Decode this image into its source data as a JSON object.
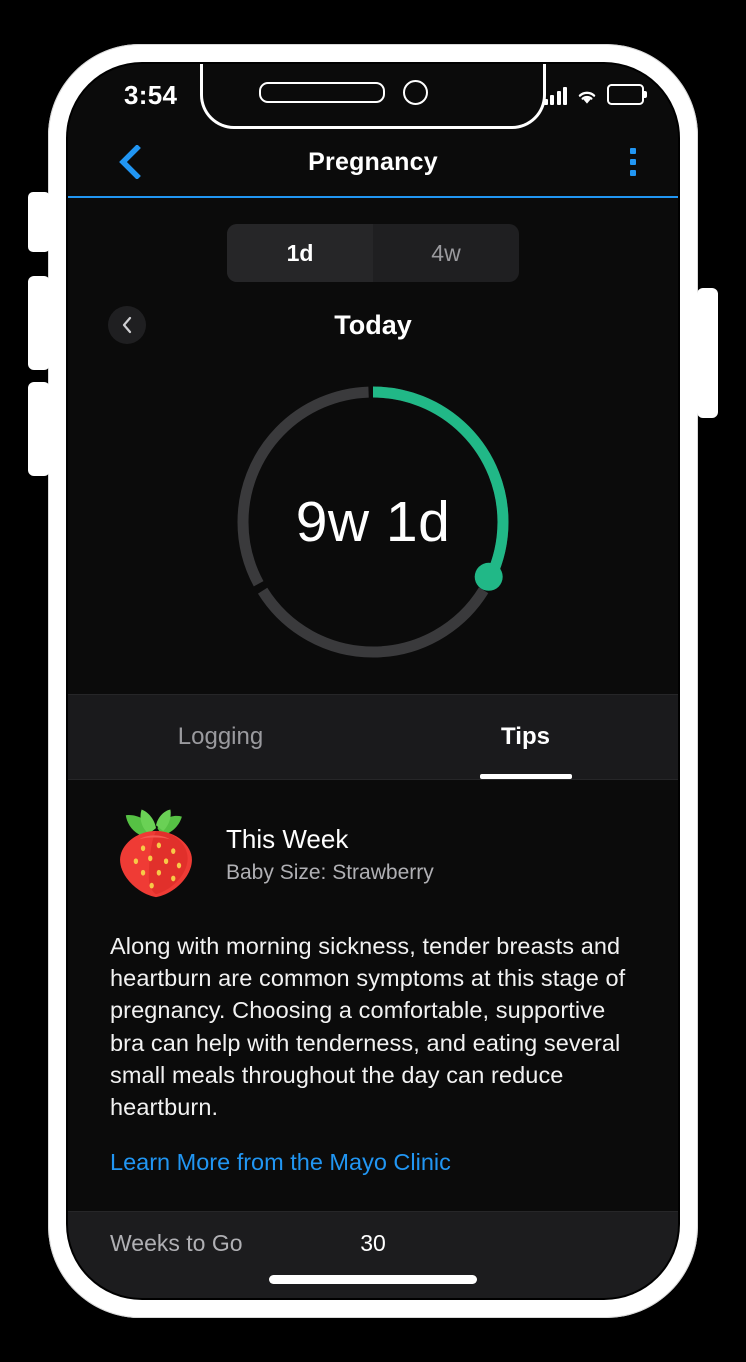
{
  "status_bar": {
    "time": "3:54",
    "icons": [
      "cellular-signal-icon",
      "wifi-icon",
      "battery-icon"
    ]
  },
  "nav_bar": {
    "back_icon": "chevron-left-icon",
    "title": "Pregnancy",
    "menu_icon": "kebab-menu-icon",
    "accent_color": "#2196f3"
  },
  "range_selector": {
    "options": [
      {
        "label": "1d",
        "selected": true
      },
      {
        "label": "4w",
        "selected": false
      }
    ]
  },
  "day_nav": {
    "prev_icon": "chevron-left-icon",
    "label": "Today"
  },
  "progress_ring": {
    "center_label": "9w 1d",
    "weeks": 9,
    "days": 1,
    "total_weeks": 40,
    "progress_percent": 32.5,
    "track_color": "#3a3a3c",
    "progress_color": "#21b887",
    "segment_count": 3,
    "segment_gap_degrees": 4
  },
  "tabs": [
    {
      "label": "Logging",
      "active": false
    },
    {
      "label": "Tips",
      "active": true
    }
  ],
  "tips": {
    "icon": "strawberry-icon",
    "title": "This Week",
    "subtitle": "Baby Size: Strawberry",
    "body": "Along with morning sickness, tender breasts and heartburn are common symptoms at this stage of pregnancy. Choosing a comfortable, supportive bra can help with tenderness, and eating several small meals throughout the day can reduce heartburn.",
    "link_label": "Learn More from the Mayo Clinic",
    "link_color": "#2196f3"
  },
  "weeks_to_go": {
    "label": "Weeks to Go",
    "value": "30"
  }
}
